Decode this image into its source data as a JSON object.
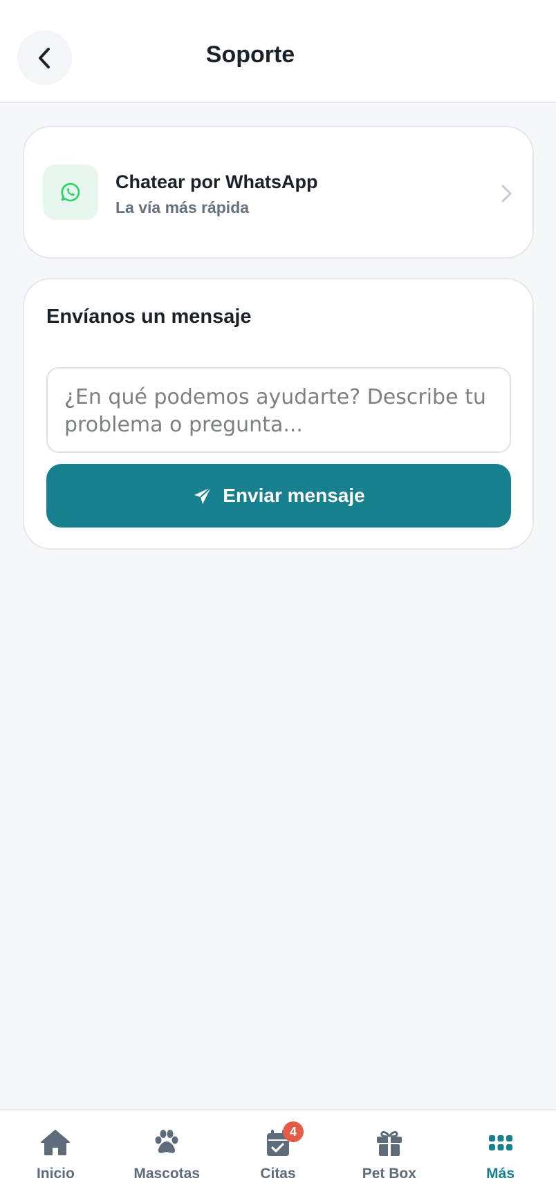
{
  "header": {
    "title": "Soporte",
    "back_icon": "chevron-left-icon"
  },
  "whatsapp": {
    "title": "Chatear por WhatsApp",
    "subtitle": "La vía más rápida",
    "icon": "whatsapp-icon",
    "icon_color": "#25d366"
  },
  "message_form": {
    "title": "Envíanos un mensaje",
    "placeholder": "¿En qué podemos ayudarte? Describe tu problema o pregunta...",
    "value": "",
    "submit_label": "Enviar mensaje",
    "submit_icon": "paper-plane-icon"
  },
  "colors": {
    "accent": "#187f8f",
    "badge": "#e45b48",
    "nav_inactive": "#5e6b79"
  },
  "bottom_nav": {
    "items": [
      {
        "label": "Inicio",
        "icon": "home-icon"
      },
      {
        "label": "Mascotas",
        "icon": "paw-icon"
      },
      {
        "label": "Citas",
        "icon": "calendar-check-icon",
        "badge": "4"
      },
      {
        "label": "Pet Box",
        "icon": "gift-icon"
      },
      {
        "label": "Más",
        "icon": "grid-icon",
        "active": true
      }
    ]
  }
}
